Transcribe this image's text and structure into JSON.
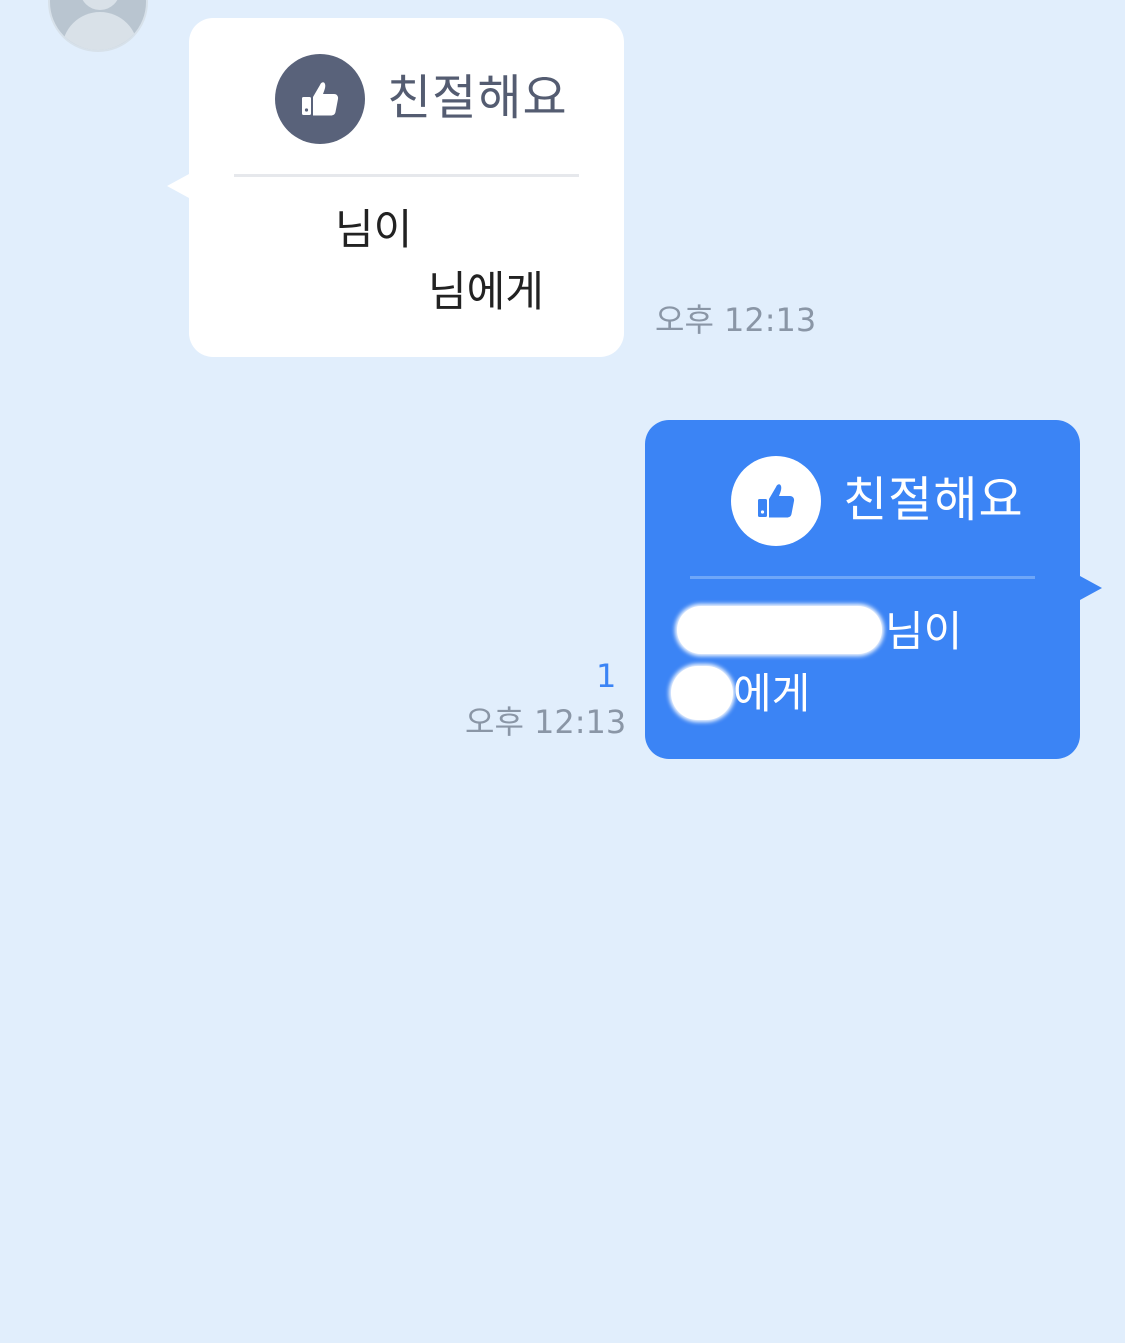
{
  "messages": {
    "incoming": {
      "reaction": "친절해요",
      "line1_suffix": "님이",
      "line2_suffix": "님에게",
      "time": "오후 12:13"
    },
    "outgoing": {
      "reaction": "친절해요",
      "line1_suffix": "님이",
      "line2_suffix": "에게",
      "time": "오후 12:13",
      "unread_count": "1"
    }
  },
  "colors": {
    "background": "#e1eefc",
    "outgoing_bubble": "#3b84f5",
    "incoming_bubble": "#ffffff",
    "incoming_badge": "#59627a",
    "timestamp": "#8a96a6",
    "unread": "#3b84f5"
  },
  "icons": {
    "reaction": "thumbs-up-icon",
    "avatar": "default-user-avatar"
  }
}
